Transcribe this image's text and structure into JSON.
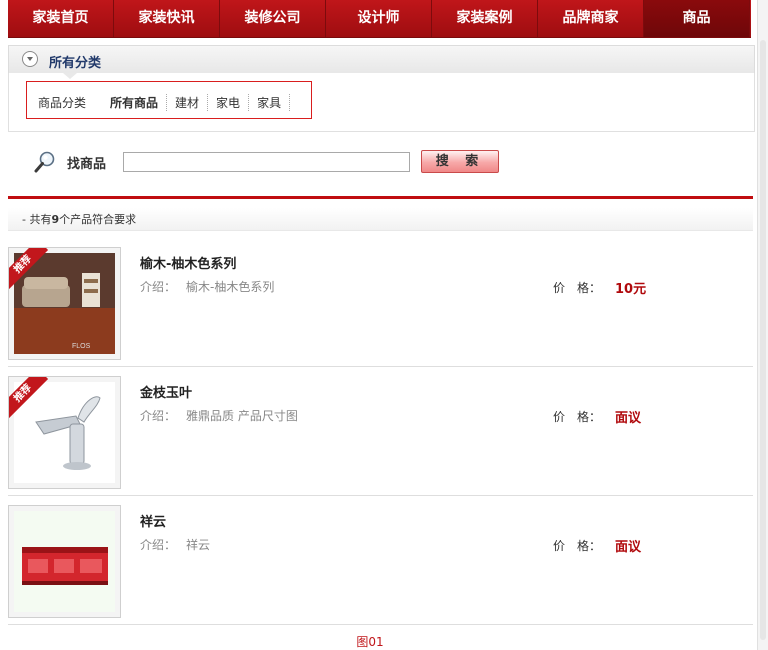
{
  "nav": {
    "items": [
      {
        "label": "家装首页"
      },
      {
        "label": "家装快讯"
      },
      {
        "label": "装修公司"
      },
      {
        "label": "设计师"
      },
      {
        "label": "家装案例"
      },
      {
        "label": "品牌商家"
      },
      {
        "label": "商品"
      }
    ],
    "active_index": 6
  },
  "category": {
    "header_title": "所有分类",
    "row_label": "商品分类",
    "tabs": [
      {
        "label": "所有商品"
      },
      {
        "label": "建材"
      },
      {
        "label": "家电"
      },
      {
        "label": "家具"
      }
    ]
  },
  "search": {
    "label": "找商品",
    "value": "",
    "button_label": "搜 索"
  },
  "results": {
    "count_prefix": "- 共有",
    "count": "9",
    "count_suffix": "个产品符合要求"
  },
  "products": [
    {
      "title": "榆木-柚木色系列",
      "desc_label": "介绍：",
      "desc": "榆木-柚木色系列",
      "price_label": "价　格：",
      "price": "10元",
      "badge": "推荐"
    },
    {
      "title": "金枝玉叶",
      "desc_label": "介绍：",
      "desc": "雅鼎品质 产品尺寸图",
      "price_label": "价　格：",
      "price": "面议",
      "badge": "推荐"
    },
    {
      "title": "祥云",
      "desc_label": "介绍：",
      "desc": "祥云",
      "price_label": "价　格：",
      "price": "面议",
      "badge": ""
    }
  ],
  "caption": "图01",
  "colors": {
    "accent": "#c0161a",
    "price": "#b0090c"
  }
}
